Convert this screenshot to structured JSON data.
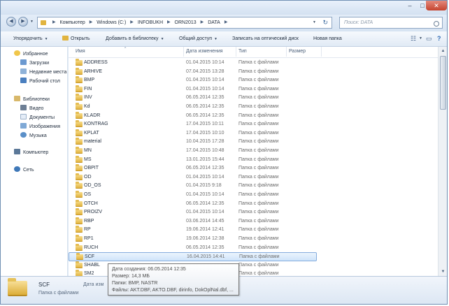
{
  "address": {
    "breadcrumbs": [
      "Компьютер",
      "Windows (C:)",
      "INFOBUKH",
      "ORN2013",
      "DATA"
    ],
    "search_placeholder": "Поиск: DATA"
  },
  "toolbar": {
    "organize": "Упорядочить",
    "open": "Открыть",
    "add_to_library": "Добавить в библиотеку",
    "share": "Общий доступ",
    "burn": "Записать на оптический диск",
    "new_folder": "Новая папка"
  },
  "sidebar": {
    "favorites": {
      "label": "Избранное",
      "items": [
        "Загрузки",
        "Недавние места",
        "Рабочий стол"
      ]
    },
    "libraries": {
      "label": "Библиотеки",
      "items": [
        "Видео",
        "Документы",
        "Изображения",
        "Музыка"
      ]
    },
    "computer": "Компьютер",
    "network": "Сеть"
  },
  "columns": {
    "name": "Имя",
    "date": "Дата изменения",
    "type": "Тип",
    "size": "Размер"
  },
  "files": [
    {
      "name": "ADDRESS",
      "date": "01.04.2015 10:14",
      "type": "Папка с файлами"
    },
    {
      "name": "ARHIVE",
      "date": "07.04.2015 13:28",
      "type": "Папка с файлами"
    },
    {
      "name": "BMP",
      "date": "01.04.2015 10:14",
      "type": "Папка с файлами"
    },
    {
      "name": "FIN",
      "date": "01.04.2015 10:14",
      "type": "Папка с файлами"
    },
    {
      "name": "INV",
      "date": "06.05.2014 12:35",
      "type": "Папка с файлами"
    },
    {
      "name": "Kd",
      "date": "06.05.2014 12:35",
      "type": "Папка с файлами"
    },
    {
      "name": "KLADR",
      "date": "06.05.2014 12:35",
      "type": "Папка с файлами"
    },
    {
      "name": "KONTRAG",
      "date": "17.04.2015 10:11",
      "type": "Папка с файлами"
    },
    {
      "name": "KPLAT",
      "date": "17.04.2015 10:10",
      "type": "Папка с файлами"
    },
    {
      "name": "material",
      "date": "10.04.2015 17:28",
      "type": "Папка с файлами"
    },
    {
      "name": "MN",
      "date": "17.04.2015 10:48",
      "type": "Папка с файлами"
    },
    {
      "name": "MS",
      "date": "13.01.2015 15:44",
      "type": "Папка с файлами"
    },
    {
      "name": "OBPIT",
      "date": "06.05.2014 12:35",
      "type": "Папка с файлами"
    },
    {
      "name": "OD",
      "date": "01.04.2015 10:14",
      "type": "Папка с файлами"
    },
    {
      "name": "OD_OS",
      "date": "01.04.2015 9:18",
      "type": "Папка с файлами"
    },
    {
      "name": "OS",
      "date": "01.04.2015 10:14",
      "type": "Папка с файлами"
    },
    {
      "name": "OTCH",
      "date": "06.05.2014 12:35",
      "type": "Папка с файлами"
    },
    {
      "name": "PROIZV",
      "date": "01.04.2015 10:14",
      "type": "Папка с файлами"
    },
    {
      "name": "RBP",
      "date": "03.06.2014 14:45",
      "type": "Папка с файлами"
    },
    {
      "name": "RP",
      "date": "19.06.2014 12:41",
      "type": "Папка с файлами"
    },
    {
      "name": "RP1",
      "date": "19.06.2014 12:38",
      "type": "Папка с файлами"
    },
    {
      "name": "RUCH",
      "date": "06.05.2014 12:35",
      "type": "Папка с файлами"
    },
    {
      "name": "SCF",
      "date": "16.04.2015 14:41",
      "type": "Папка с файлами"
    },
    {
      "name": "SHABL",
      "date": "",
      "type": "Папка с файлами"
    },
    {
      "name": "SM2",
      "date": "",
      "type": "Папка с файлами"
    }
  ],
  "selected": "SCF",
  "tooltip": {
    "created": "Дата создания: 06.05.2014 12:35",
    "size": "Размер: 14,3 МБ",
    "folders": "Папки: BMP, NASTR",
    "files": "Файлы: AKT.DBF, AKTO.DBF, dirinfo, DokOplNal.dbf, ..."
  },
  "details": {
    "name": "SCF",
    "type": "Папка с файлами",
    "date_label": "Дата изм"
  },
  "colors": {
    "accent": "#cfe4fa",
    "folder": "#e1b43f",
    "frame": "#dfe9f5"
  }
}
